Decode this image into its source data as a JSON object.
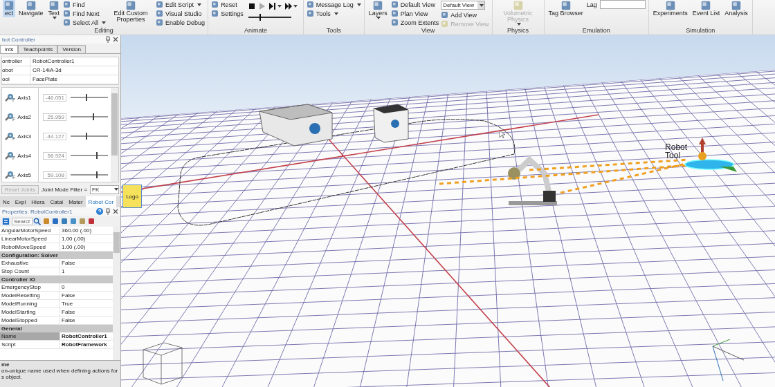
{
  "ribbon": {
    "groups": [
      {
        "label": "Editing",
        "items": [
          {
            "kind": "large",
            "label": "ect",
            "selected": true,
            "disabled": false,
            "caret": false
          },
          {
            "kind": "large",
            "label": "Navigate",
            "selected": false,
            "disabled": false,
            "caret": false
          },
          {
            "kind": "large",
            "label": "Text",
            "selected": false,
            "disabled": false,
            "caret": true
          },
          {
            "kind": "small",
            "label": "Find",
            "selected": false,
            "disabled": false,
            "caret": false
          },
          {
            "kind": "small",
            "label": "Find Next",
            "selected": false,
            "disabled": false,
            "caret": false
          },
          {
            "kind": "small",
            "label": "Select All",
            "selected": false,
            "disabled": false,
            "caret": true
          },
          {
            "kind": "large",
            "label": "Edit Custom Properties",
            "selected": false,
            "disabled": false,
            "caret": false
          },
          {
            "kind": "small",
            "label": "Edit Script",
            "selected": false,
            "disabled": false,
            "caret": true
          },
          {
            "kind": "small",
            "label": "Visual Studio",
            "selected": false,
            "disabled": false,
            "caret": false
          },
          {
            "kind": "small",
            "label": "Enable Debug",
            "selected": false,
            "disabled": false,
            "caret": false
          }
        ]
      },
      {
        "label": "Animate",
        "items": [
          {
            "kind": "small",
            "label": "Reset",
            "selected": false,
            "disabled": false,
            "caret": false
          },
          {
            "kind": "small",
            "label": "Settings",
            "selected": false,
            "disabled": false,
            "caret": false
          },
          {
            "kind": "player",
            "level": 0.26,
            "buttons": [
              {
                "kind": "stop",
                "disabled": false,
                "caret": false
              },
              {
                "kind": "play",
                "disabled": true,
                "caret": false
              },
              {
                "kind": "step",
                "disabled": false,
                "caret": true
              },
              {
                "kind": "fast",
                "disabled": false,
                "caret": true
              }
            ]
          }
        ]
      },
      {
        "label": "Tools",
        "items": [
          {
            "kind": "small",
            "label": "Message Log",
            "selected": false,
            "disabled": false,
            "caret": true
          },
          {
            "kind": "small",
            "label": "Tools",
            "selected": false,
            "disabled": false,
            "caret": true
          }
        ]
      },
      {
        "label": "View",
        "items": [
          {
            "kind": "large",
            "label": "Layers",
            "selected": false,
            "disabled": false,
            "caret": true
          },
          {
            "kind": "small",
            "label": "Default View",
            "selected": false,
            "disabled": false,
            "caret": false
          },
          {
            "kind": "small",
            "label": "Plan View",
            "selected": false,
            "disabled": false,
            "caret": false
          },
          {
            "kind": "small",
            "label": "Zoom Extents",
            "selected": false,
            "disabled": false,
            "caret": false
          },
          {
            "kind": "dropdown",
            "label": "Default View"
          },
          {
            "kind": "small",
            "label": "Add View",
            "selected": false,
            "disabled": false,
            "caret": false
          },
          {
            "kind": "small",
            "label": "Remove View",
            "selected": false,
            "disabled": true,
            "caret": false
          }
        ]
      },
      {
        "label": "Physics",
        "items": [
          {
            "kind": "large",
            "label": "Volumetric Physics",
            "selected": false,
            "disabled": true,
            "caret": true
          }
        ]
      },
      {
        "label": "Emulation",
        "items": [
          {
            "kind": "large",
            "label": "Tag Browser",
            "selected": false,
            "disabled": false,
            "caret": false
          },
          {
            "kind": "field",
            "label": "Lag"
          }
        ]
      },
      {
        "label": "Simulation",
        "items": [
          {
            "kind": "large",
            "label": "Experiments",
            "selected": false,
            "disabled": false,
            "caret": false
          },
          {
            "kind": "large",
            "label": "Event List",
            "selected": false,
            "disabled": false,
            "caret": false
          },
          {
            "kind": "large",
            "label": "Analysis",
            "selected": false,
            "disabled": false,
            "caret": false
          }
        ]
      }
    ]
  },
  "robot_controller": {
    "title": "bot Controller",
    "tabs": [
      {
        "label": "ints",
        "selected": true
      },
      {
        "label": "Teachpoints",
        "selected": false
      },
      {
        "label": "Version",
        "selected": false
      }
    ],
    "info": [
      {
        "label": "ontroller",
        "value": "RobotController1"
      },
      {
        "label": "obot",
        "value": "CR-14iA-3d"
      },
      {
        "label": "ool",
        "value": "FacePlate"
      }
    ],
    "axes": [
      {
        "name": "Axis1",
        "mode": "F",
        "value": "-46.051",
        "level": 0.4
      },
      {
        "name": "Axis2",
        "mode": "F",
        "value": "25.959",
        "level": 0.6
      },
      {
        "name": "Axis3",
        "mode": "F",
        "value": "-44.127",
        "level": 0.4
      },
      {
        "name": "Axis4",
        "mode": "F",
        "value": "56.924",
        "level": 0.68
      },
      {
        "name": "Axis5",
        "mode": "F",
        "value": "59.108",
        "level": 0.68
      }
    ],
    "reset_button": {
      "label": "Reset Joints",
      "disabled": true
    },
    "filter": {
      "label": "Joint Mode Filter =",
      "value": "FK"
    }
  },
  "dock_tabs": [
    {
      "label": "Nc",
      "selected": false
    },
    {
      "label": "Expl",
      "selected": false
    },
    {
      "label": "Hiera",
      "selected": false
    },
    {
      "label": "Catal",
      "selected": false
    },
    {
      "label": "Mater",
      "selected": false
    },
    {
      "label": "Robot Cor",
      "selected": true
    }
  ],
  "properties": {
    "title": "Properties: RobotController1",
    "search": {
      "placeholder": "Search"
    },
    "rows": [
      {
        "kind": "property",
        "name": "AngularMotorSpeed",
        "value": "360.00 (.00)",
        "selected": false,
        "modified": false
      },
      {
        "kind": "property",
        "name": "LinearMotorSpeed",
        "value": "1.00 (.00)",
        "selected": false,
        "modified": false
      },
      {
        "kind": "property",
        "name": "RobotMoveSpeed",
        "value": "1.00 (.00)",
        "selected": false,
        "modified": false
      },
      {
        "kind": "category",
        "name": "Configuration: Solver"
      },
      {
        "kind": "property",
        "name": "Exhaustive",
        "value": "False",
        "selected": false,
        "modified": false
      },
      {
        "kind": "property",
        "name": "Stop Count",
        "value": "1",
        "selected": false,
        "modified": false
      },
      {
        "kind": "category",
        "name": "Controller IO"
      },
      {
        "kind": "property",
        "name": "EmergencyStop",
        "value": "0",
        "selected": false,
        "modified": false
      },
      {
        "kind": "property",
        "name": "ModelResetting",
        "value": "False",
        "selected": false,
        "modified": false
      },
      {
        "kind": "property",
        "name": "ModelRunning",
        "value": "True",
        "selected": false,
        "modified": false
      },
      {
        "kind": "property",
        "name": "ModelStarting",
        "value": "False",
        "selected": false,
        "modified": false
      },
      {
        "kind": "property",
        "name": "ModelStopped",
        "value": "False",
        "selected": false,
        "modified": false
      },
      {
        "kind": "category",
        "name": "General"
      },
      {
        "kind": "property",
        "name": "Name",
        "value": "RobotController1",
        "selected": true,
        "modified": true
      },
      {
        "kind": "property",
        "name": "Script",
        "value": "RobotFramework",
        "selected": false,
        "modified": true
      }
    ],
    "description": {
      "title": "me",
      "lines": [
        "on-unique name used when defining actions for",
        "s object."
      ]
    }
  },
  "viewport": {
    "tool_label": "Robot Tool",
    "sign_label": "Logo"
  }
}
